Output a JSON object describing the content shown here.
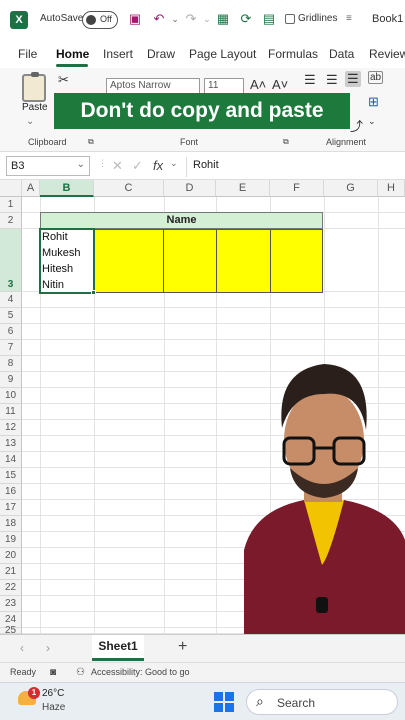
{
  "titlebar": {
    "autosave_label": "AutoSave",
    "autosave_state": "Off",
    "gridlines_label": "Gridlines",
    "workbook_name": "Book1"
  },
  "ribbon_tabs": [
    "File",
    "Home",
    "Insert",
    "Draw",
    "Page Layout",
    "Formulas",
    "Data",
    "Review"
  ],
  "ribbon": {
    "paste_label": "Paste",
    "clipboard_label": "Clipboard",
    "font_label": "Font",
    "alignment_label": "Alignment",
    "font_name": "Aptos Narrow",
    "font_size": "11"
  },
  "banner_text": "Don't do copy and paste",
  "formula_bar": {
    "name_box": "B3",
    "fx": "fx",
    "value": "Rohit"
  },
  "sheet": {
    "columns": [
      "A",
      "B",
      "C",
      "D",
      "E",
      "F",
      "G",
      "H"
    ],
    "rows": [
      "1",
      "2",
      "3",
      "4",
      "5",
      "6",
      "7",
      "8",
      "9",
      "10",
      "11",
      "12",
      "13",
      "14",
      "15",
      "16",
      "17",
      "18",
      "19",
      "20",
      "21",
      "22",
      "23",
      "24",
      "25"
    ],
    "name_header": "Name",
    "b3_values": [
      "Rohit",
      "Mukesh",
      "Hitesh",
      "Nitin"
    ]
  },
  "sheet_tabs": {
    "active": "Sheet1"
  },
  "status": {
    "ready": "Ready",
    "accessibility": "Accessibility: Good to go"
  },
  "taskbar": {
    "temp": "26°C",
    "weather": "Haze",
    "badge": "1",
    "search": "Search"
  },
  "colors": {
    "excel_green": "#1e7145",
    "banner_green": "#1e7a3c",
    "header_fill": "#d4f0d4",
    "yellow_fill": "#ffff00"
  }
}
